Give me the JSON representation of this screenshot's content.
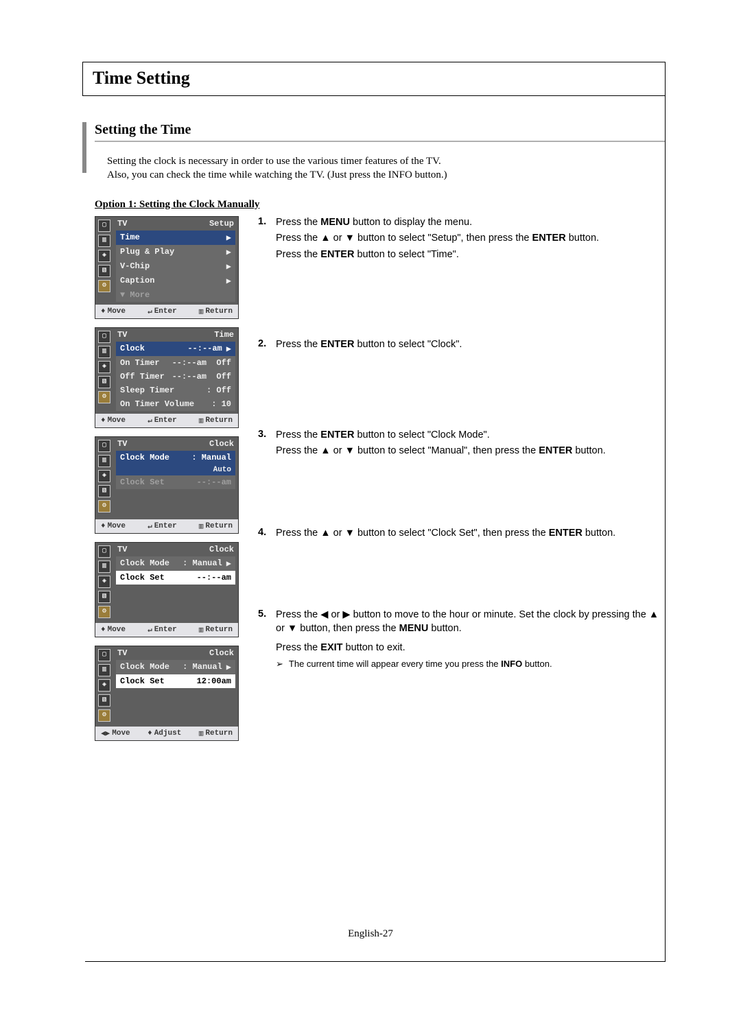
{
  "page": {
    "header": "Time Setting",
    "subheader": "Setting the Time",
    "footer": "English-27"
  },
  "intro": {
    "line1": "Setting the clock is necessary in order to use the various timer features of the TV.",
    "line2": "Also, you can check the time while watching the TV. (Just press the INFO button.)"
  },
  "option1_title": "Option 1: Setting the Clock Manually",
  "steps": {
    "s1": {
      "num": "1.",
      "a": "Press the ",
      "b": "MENU",
      "c": " button to display the menu.",
      "d": "Press the ",
      "e": "▲",
      "f": " or ",
      "g": "▼",
      "h": " button to select \"Setup\", then press the ",
      "i": "ENTER",
      "j": " button.",
      "k": "Press the ",
      "l": "ENTER",
      "m": " button to select \"Time\"."
    },
    "s2": {
      "num": "2.",
      "a": "Press the ",
      "b": "ENTER",
      "c": " button to select \"Clock\"."
    },
    "s3": {
      "num": "3.",
      "a": "Press the ",
      "b": "ENTER",
      "c": " button to select \"Clock Mode\".",
      "d": "Press the ",
      "e": "▲",
      "f": " or ",
      "g": "▼",
      "h": " button to select \"Manual\", then press the ",
      "i": "ENTER",
      "j": " button."
    },
    "s4": {
      "num": "4.",
      "a": "Press the ",
      "b": "▲",
      "c": " or ",
      "d": "▼",
      "e": " button to select \"Clock Set\", then press the ",
      "f": "ENTER",
      "g": " button."
    },
    "s5": {
      "num": "5.",
      "a": "Press the ",
      "b": "◀",
      "c": " or ",
      "d": "▶",
      "e": " button to move to the hour or minute. Set the clock by pressing the ",
      "f": "▲",
      "g": " or ",
      "h": "▼",
      "i": " button, then press the ",
      "j": "MENU",
      "k": " button.",
      "l": "Press the ",
      "m": "EXIT",
      "n": " button to exit.",
      "note_arrow": "➢",
      "note_a": "The current time will appear every time you press the ",
      "note_b": "INFO",
      "note_c": " button."
    }
  },
  "osd_common": {
    "tv": "TV",
    "footer_move_ud": "Move",
    "footer_move_ud_sym": "♦",
    "footer_move_lr": "Move",
    "footer_move_lr_sym": "◀▶",
    "footer_enter": "Enter",
    "footer_enter_sym": "↵",
    "footer_adjust": "Adjust",
    "footer_adjust_sym": "♦",
    "footer_return": "Return",
    "footer_return_sym": "▥"
  },
  "osd1": {
    "title": "Setup",
    "items": [
      {
        "label": "Time",
        "arrow": "▶",
        "selected": true
      },
      {
        "label": "Plug & Play",
        "arrow": "▶"
      },
      {
        "label": "V-Chip",
        "arrow": "▶"
      },
      {
        "label": "Caption",
        "arrow": "▶"
      },
      {
        "label": "▼ More",
        "muted": true
      }
    ]
  },
  "osd2": {
    "title": "Time",
    "items": [
      {
        "label": "Clock",
        "val": "--:--am",
        "arrow": "▶",
        "selected": true
      },
      {
        "label": "On Timer",
        "val": "--:--am  Off"
      },
      {
        "label": "Off Timer",
        "val": "--:--am  Off"
      },
      {
        "label": "Sleep Timer",
        "val": ": Off"
      },
      {
        "label": "On Timer Volume",
        "val": ": 10"
      }
    ]
  },
  "osd3": {
    "title": "Clock",
    "items": [
      {
        "label": "Clock Mode",
        "val": ": Manual",
        "selected": true,
        "sub": "Auto",
        "sub_white": false
      },
      {
        "label": "Clock Set",
        "val": "--:--am",
        "muted": true
      }
    ]
  },
  "osd4": {
    "title": "Clock",
    "items": [
      {
        "label": "Clock Mode",
        "val": ": Manual",
        "arrow": "▶"
      },
      {
        "label": "Clock Set",
        "val": "--:--am",
        "selected": true,
        "white_row": true
      }
    ]
  },
  "osd5": {
    "title": "Clock",
    "items": [
      {
        "label": "Clock Mode",
        "val": ": Manual",
        "arrow": "▶"
      },
      {
        "label": "Clock Set",
        "val": "12:00am",
        "selected": true,
        "white_row": true
      }
    ]
  },
  "icons": [
    "▢",
    "▥",
    "◈",
    "▧",
    "⚙"
  ]
}
